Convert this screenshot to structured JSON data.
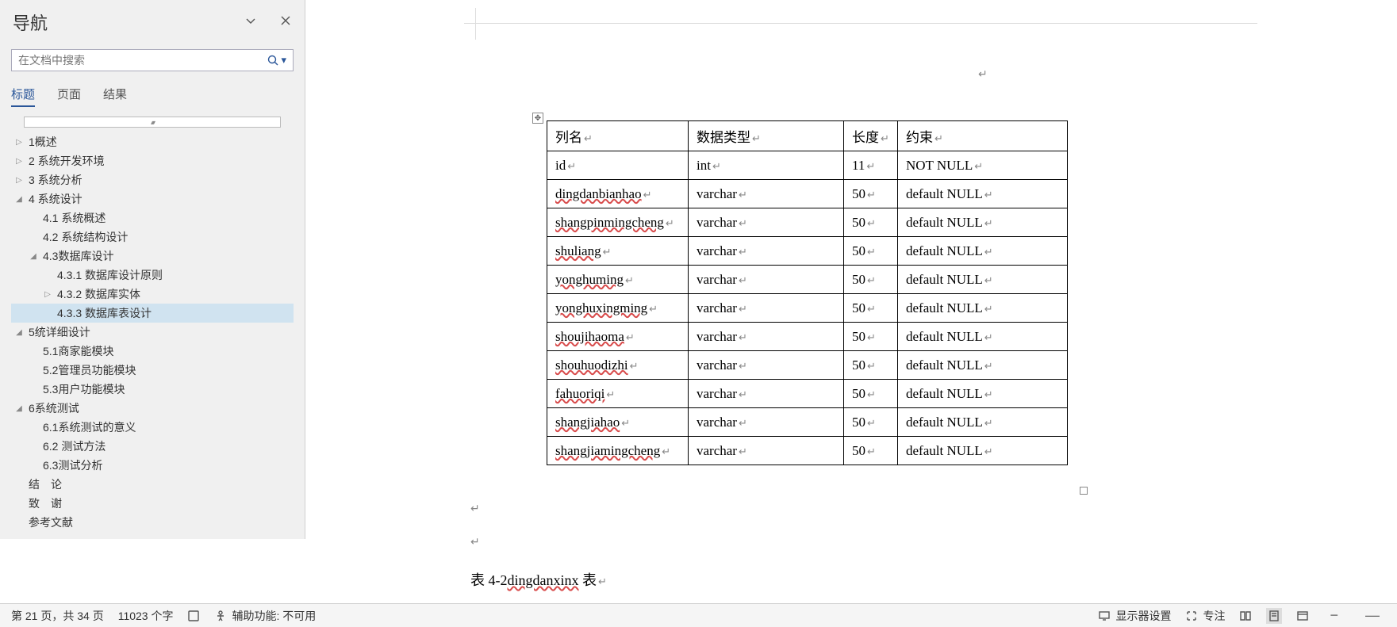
{
  "nav": {
    "title": "导航",
    "search_placeholder": "在文档中搜索",
    "tabs": {
      "headings": "标题",
      "pages": "页面",
      "results": "结果"
    },
    "tree": [
      {
        "label": "1概述",
        "indent": 0,
        "toggle": "▷"
      },
      {
        "label": "2 系统开发环境",
        "indent": 0,
        "toggle": "▷"
      },
      {
        "label": "3 系统分析",
        "indent": 0,
        "toggle": "▷"
      },
      {
        "label": "4 系统设计",
        "indent": 0,
        "toggle": "◢"
      },
      {
        "label": "4.1 系统概述",
        "indent": 1,
        "toggle": ""
      },
      {
        "label": "4.2 系统结构设计",
        "indent": 1,
        "toggle": ""
      },
      {
        "label": "4.3数据库设计",
        "indent": 1,
        "toggle": "◢"
      },
      {
        "label": "4.3.1 数据库设计原则",
        "indent": 2,
        "toggle": ""
      },
      {
        "label": "4.3.2 数据库实体",
        "indent": 2,
        "toggle": "▷"
      },
      {
        "label": "4.3.3 数据库表设计",
        "indent": 2,
        "toggle": "",
        "selected": true
      },
      {
        "label": "5统详细设计",
        "indent": 0,
        "toggle": "◢"
      },
      {
        "label": "5.1商家能模块",
        "indent": 1,
        "toggle": ""
      },
      {
        "label": "5.2管理员功能模块",
        "indent": 1,
        "toggle": ""
      },
      {
        "label": "5.3用户功能模块",
        "indent": 1,
        "toggle": ""
      },
      {
        "label": "6系统测试",
        "indent": 0,
        "toggle": "◢"
      },
      {
        "label": "6.1系统测试的意义",
        "indent": 1,
        "toggle": ""
      },
      {
        "label": "6.2 测试方法",
        "indent": 1,
        "toggle": ""
      },
      {
        "label": "6.3测试分析",
        "indent": 1,
        "toggle": ""
      },
      {
        "label": "结　论",
        "indent": 0,
        "toggle": ""
      },
      {
        "label": "致　谢",
        "indent": 0,
        "toggle": ""
      },
      {
        "label": "参考文献",
        "indent": 0,
        "toggle": ""
      }
    ]
  },
  "table": {
    "headers": {
      "col1": "列名",
      "col2": "数据类型",
      "col3": "长度",
      "col4": "约束"
    },
    "rows": [
      {
        "name": "id",
        "type": "int",
        "len": "11",
        "cons": "NOT NULL",
        "squiggle": false
      },
      {
        "name": "dingdanbianhao",
        "type": "varchar",
        "len": "50",
        "cons": " default NULL",
        "squiggle": true
      },
      {
        "name": "shangpinmingcheng",
        "type": "varchar",
        "len": "50",
        "cons": " default NULL",
        "squiggle": true
      },
      {
        "name": "shuliang",
        "type": "varchar",
        "len": "50",
        "cons": " default NULL",
        "squiggle": true
      },
      {
        "name": "yonghuming",
        "type": "varchar",
        "len": "50",
        "cons": " default NULL",
        "squiggle": true
      },
      {
        "name": "yonghuxingming",
        "type": "varchar",
        "len": "50",
        "cons": " default NULL",
        "squiggle": true
      },
      {
        "name": "shoujihaoma",
        "type": "varchar",
        "len": "50",
        "cons": " default NULL",
        "squiggle": true
      },
      {
        "name": "shouhuodizhi",
        "type": "varchar",
        "len": "50",
        "cons": " default NULL",
        "squiggle": true
      },
      {
        "name": "fahuoriqi",
        "type": "varchar",
        "len": "50",
        "cons": " default NULL",
        "squiggle": true
      },
      {
        "name": "shangjiahao",
        "type": "varchar",
        "len": "50",
        "cons": " default NULL",
        "squiggle": true
      },
      {
        "name": "shangjiamingcheng",
        "type": "varchar",
        "len": "50",
        "cons": " default NULL",
        "squiggle": true
      }
    ]
  },
  "caption_prefix": "表 4-2",
  "caption_name": "dingdanxinx",
  "caption_suffix": " 表",
  "status": {
    "page": "第 21 页，共 34 页",
    "words": "11023 个字",
    "a11y_label": "辅助功能: 不可用",
    "display": "显示器设置",
    "focus": "专注"
  }
}
